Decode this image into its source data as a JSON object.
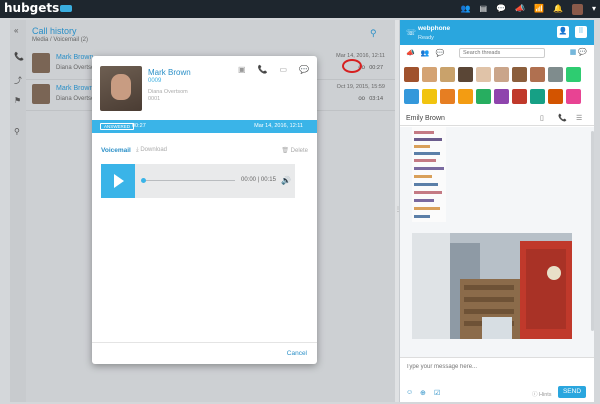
{
  "app": {
    "logo": "hubgets"
  },
  "topbar": {
    "icons": [
      "people-icon",
      "contacts-icon",
      "chat-icon",
      "megaphone-icon",
      "signal-icon",
      "bell-icon",
      "avatar",
      "caret-icon"
    ]
  },
  "call_history": {
    "title": "Call history",
    "subtitle": "Media / Voicemail (2)",
    "rows": [
      {
        "name": "Mark Brown",
        "org": "Diana Overtsom",
        "date": "Mar 14, 2016, 12:11",
        "duration": "00:27"
      },
      {
        "name": "Mark Brown",
        "org": "Diana Overtsom",
        "date": "Oct 19, 2015, 15:59",
        "duration": "03:14"
      }
    ]
  },
  "modal": {
    "name": "Mark Brown",
    "extension": "0009",
    "org": "Diana Overtsom",
    "ext2": "0001",
    "badge": "ANSWERED",
    "duration": "00:27",
    "date": "Mar 14, 2016, 12:11",
    "voicemail_label": "Voicemail",
    "download_label": "Download",
    "delete_label": "Delete",
    "time": "00:00 | 00:15",
    "progress": 0,
    "cancel_label": "Cancel"
  },
  "right_panel": {
    "title": "webphone",
    "status": "Ready",
    "search_placeholder": "Search threads",
    "conversation_name": "Emily Brown",
    "message_placeholder": "Type your message here...",
    "hints_label": "Hints",
    "send_label": "SEND"
  },
  "colors": {
    "accent": "#2aa6de",
    "link": "#2a8fc7",
    "highlight": "#d62020",
    "green": "#2cb34a",
    "topbar": "#1e262e"
  }
}
